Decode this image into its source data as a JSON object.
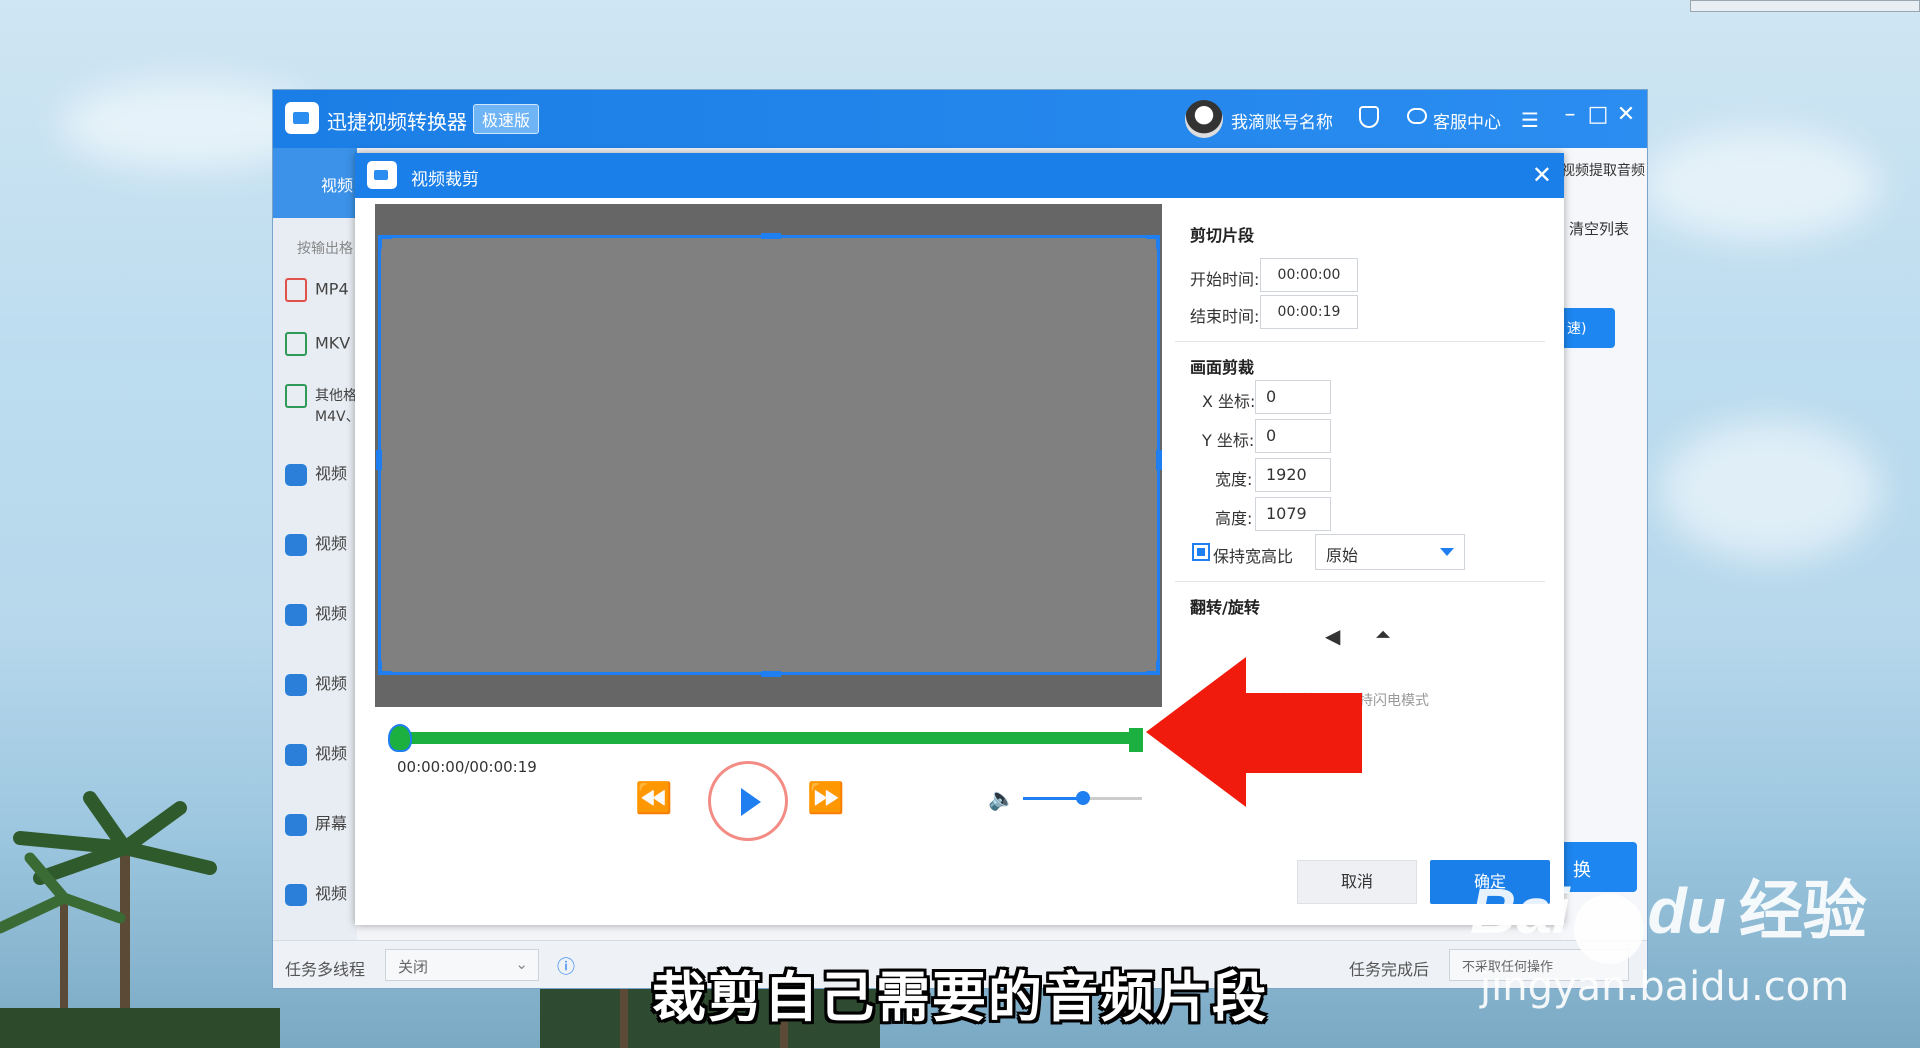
{
  "app": {
    "title": "迅捷视频转换器",
    "edition_badge": "极速版",
    "account_name": "我滴账号名称",
    "service_label": "客服中心",
    "sidebar_header": "视频",
    "output_format_hint": "按输出格",
    "formats": [
      "MP4",
      "MKV",
      "其他格",
      "M4V、"
    ],
    "nav_items": [
      "视频",
      "视频",
      "视频",
      "视频",
      "视频",
      "屏幕",
      "视频"
    ],
    "right_top_text": "视频提取音频",
    "right_clear_text": "清空列表",
    "right_speed_text": "速)",
    "right_convert_text": "换",
    "bottom": {
      "multithread_label": "任务多线程",
      "multithread_value": "关闭",
      "after_finish_label": "任务完成后",
      "after_finish_value": "不采取任何操作"
    }
  },
  "dialog": {
    "title": "视频裁剪",
    "cut_section_title": "剪切片段",
    "start_time_label": "开始时间:",
    "start_time_value": "00:00:00",
    "end_time_label": "结束时间:",
    "end_time_value": "00:00:19",
    "crop_section_title": "画面剪裁",
    "x_label": "X 坐标:",
    "x_value": "0",
    "y_label": "Y 坐标:",
    "y_value": "0",
    "width_label": "宽度:",
    "width_value": "1920",
    "height_label": "高度:",
    "height_value": "1079",
    "keep_ratio_label": "保持宽高比",
    "ratio_select_value": "原始",
    "flip_section_title": "翻转/旋转",
    "flip_note": "操作后，格式转换将不支持闪电模式",
    "time_readout": "00:00:00/00:00:19",
    "volume_level": 0.5,
    "cancel_label": "取消",
    "ok_label": "确定"
  },
  "subtitle": "裁剪自己需要的音频片段",
  "watermark": {
    "brand": "Bai",
    "brand_tail": "du",
    "brand_cn": "经验",
    "url": "jingyan.baidu.com"
  },
  "colors": {
    "accent": "#1b7fe9",
    "timeline": "#1cb040",
    "arrow": "#f01b0c"
  }
}
